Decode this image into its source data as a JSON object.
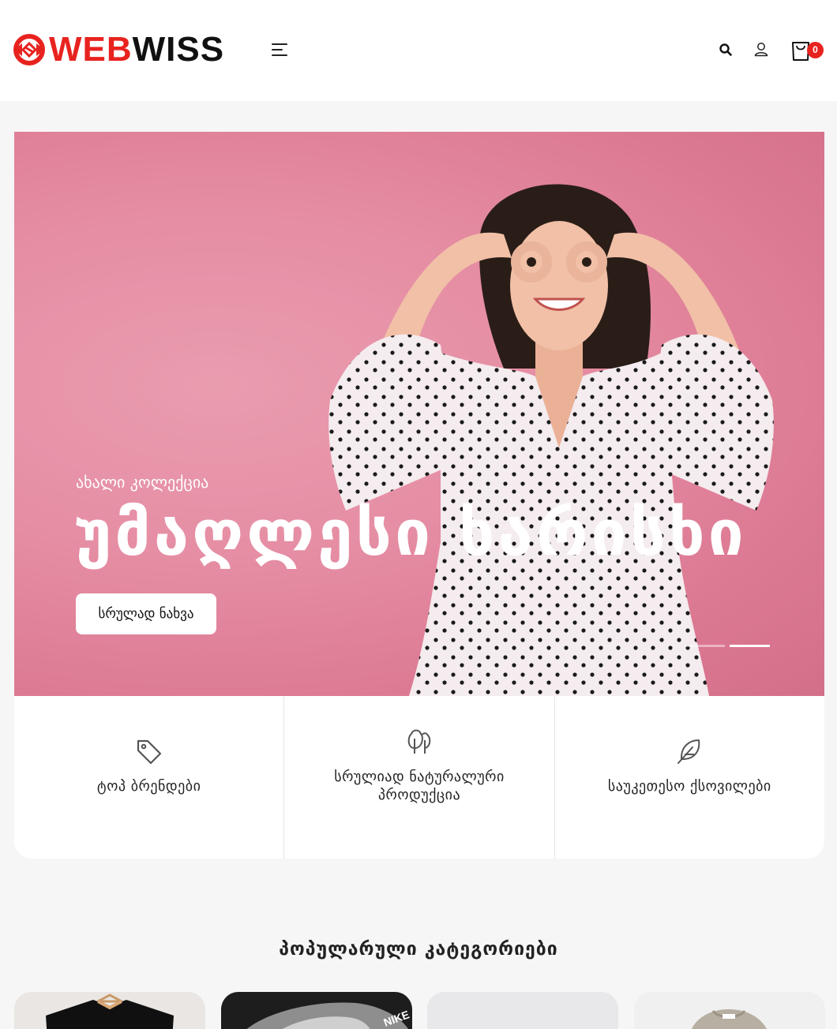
{
  "header": {
    "logo_red": "WEB",
    "logo_dark": "WISS",
    "cart_count": "0"
  },
  "hero": {
    "kicker": "ახალი კოლექცია",
    "title": "უმაღლესი ხარისხი",
    "cta_label": "სრულად ნახვა",
    "slides_total": 2,
    "active_slide": 2
  },
  "features": [
    {
      "icon": "tag-icon",
      "label": "ტოპ ბრენდები"
    },
    {
      "icon": "trees-icon",
      "label": "სრულიად ნატურალური პროდუქცია"
    },
    {
      "icon": "feather-icon",
      "label": "საუკეთესო ქსოვილები"
    }
  ],
  "categories_section": {
    "title": "პოპულარული კატეგორიები",
    "items": [
      {
        "icon": "tshirt-on-hanger-image"
      },
      {
        "icon": "sneaker-image",
        "text": "NIKE"
      },
      {
        "icon": "product-image"
      },
      {
        "icon": "sweater-image"
      }
    ]
  },
  "colors": {
    "brand_red": "#e8231f",
    "hero_pink": "#e58da3"
  }
}
